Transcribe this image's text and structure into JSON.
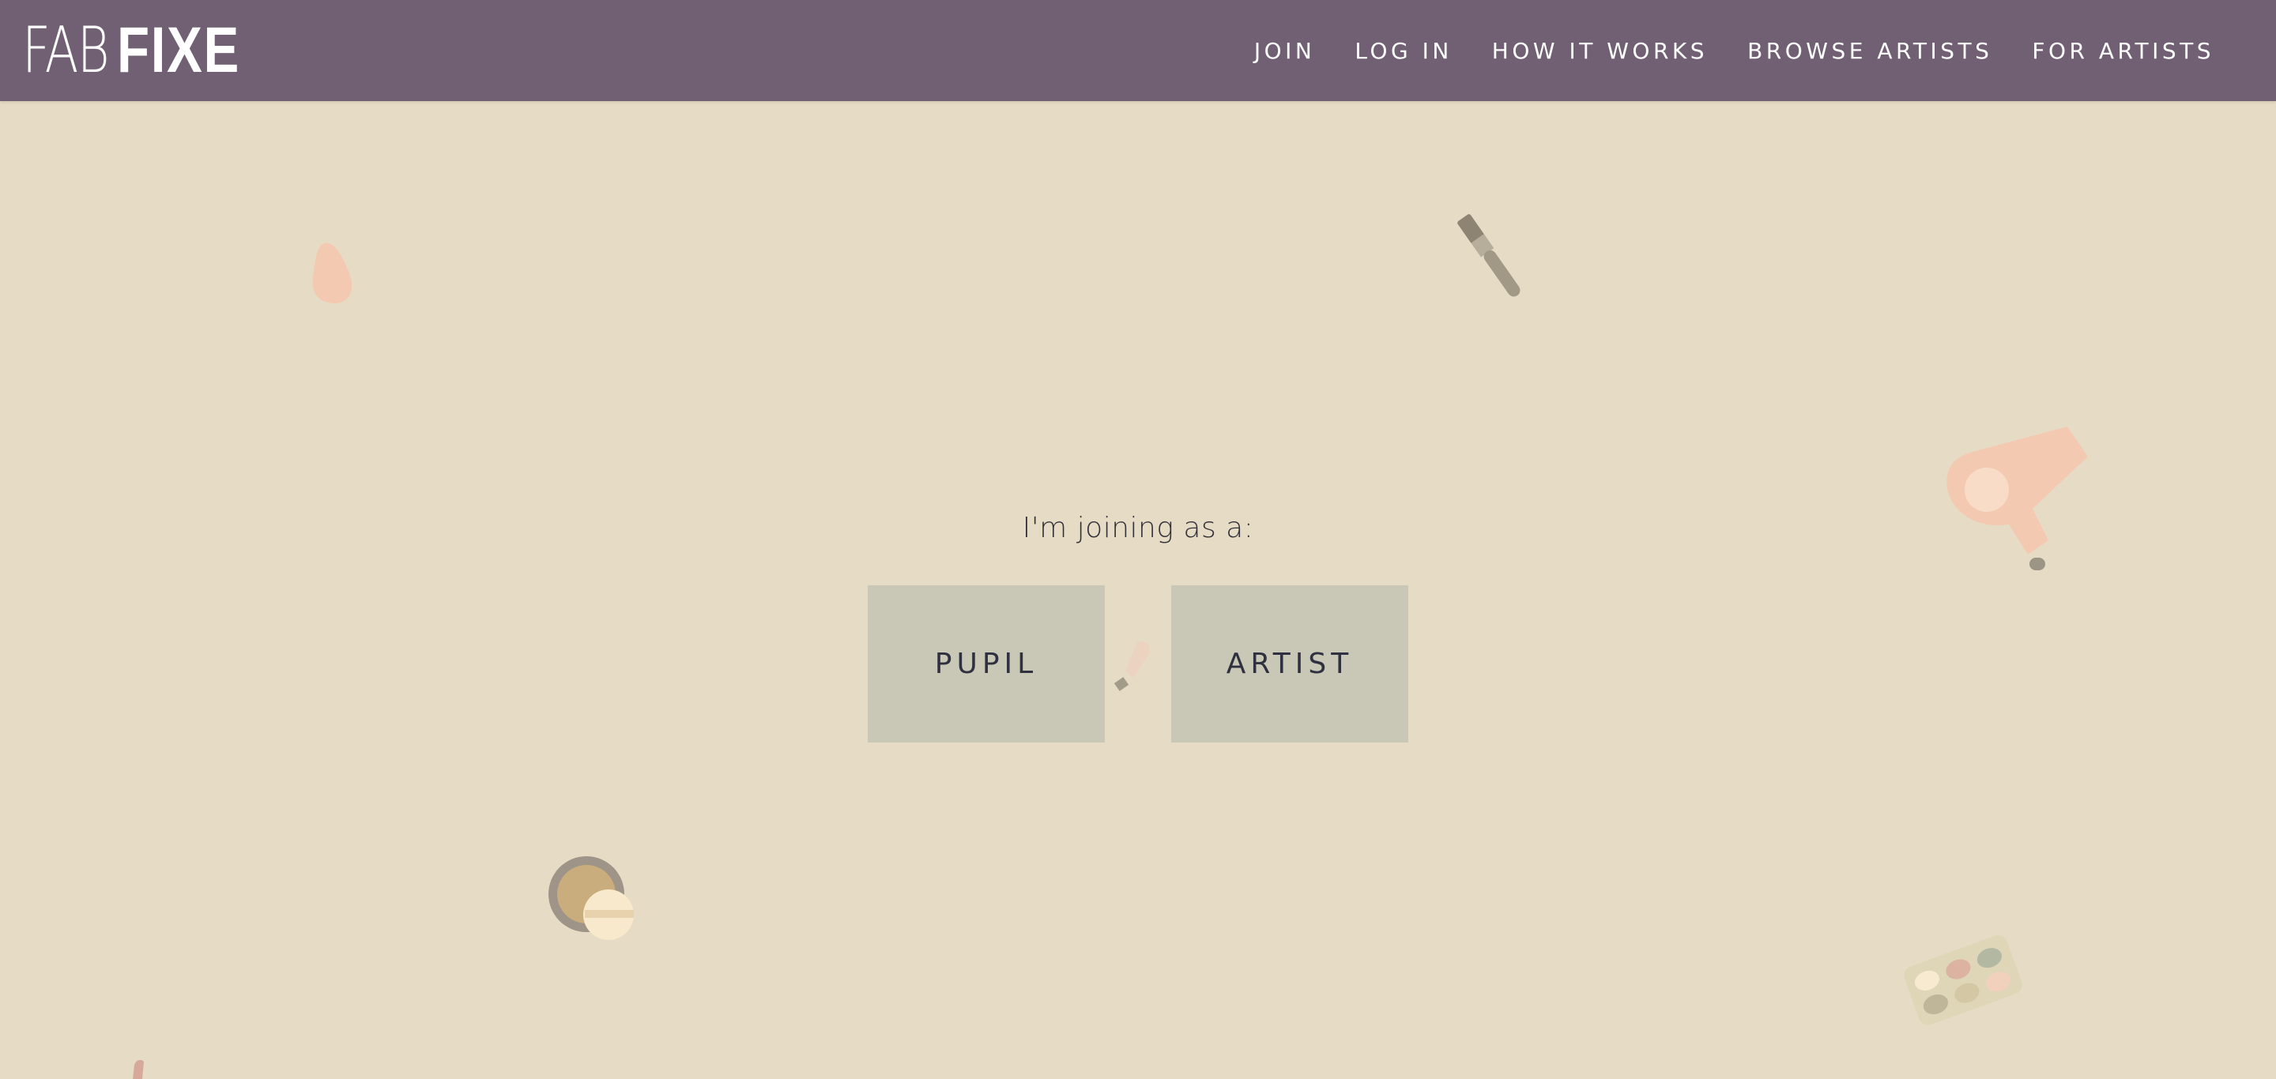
{
  "header": {
    "logo_light": "FAB",
    "logo_bold": "FIXE",
    "nav": [
      {
        "label": "JOIN"
      },
      {
        "label": "LOG IN"
      },
      {
        "label": "HOW IT WORKS"
      },
      {
        "label": "BROWSE ARTISTS"
      },
      {
        "label": "FOR ARTISTS"
      }
    ]
  },
  "main": {
    "prompt": "I'm joining as a:",
    "choices": [
      {
        "label": "PUPIL"
      },
      {
        "label": "ARTIST"
      }
    ]
  },
  "colors": {
    "header_bg": "#716073",
    "page_bg": "#e6dcc5",
    "button_bg": "#c9c7b6",
    "button_text": "#2f3140",
    "accent_peach": "#f4c9b2"
  },
  "decorations": [
    {
      "icon": "sponge-icon"
    },
    {
      "icon": "makeup-brush-icon"
    },
    {
      "icon": "hair-dryer-icon"
    },
    {
      "icon": "small-brush-icon"
    },
    {
      "icon": "compact-powder-icon"
    },
    {
      "icon": "eyeshadow-palette-icon"
    },
    {
      "icon": "lipstick-icon"
    }
  ]
}
